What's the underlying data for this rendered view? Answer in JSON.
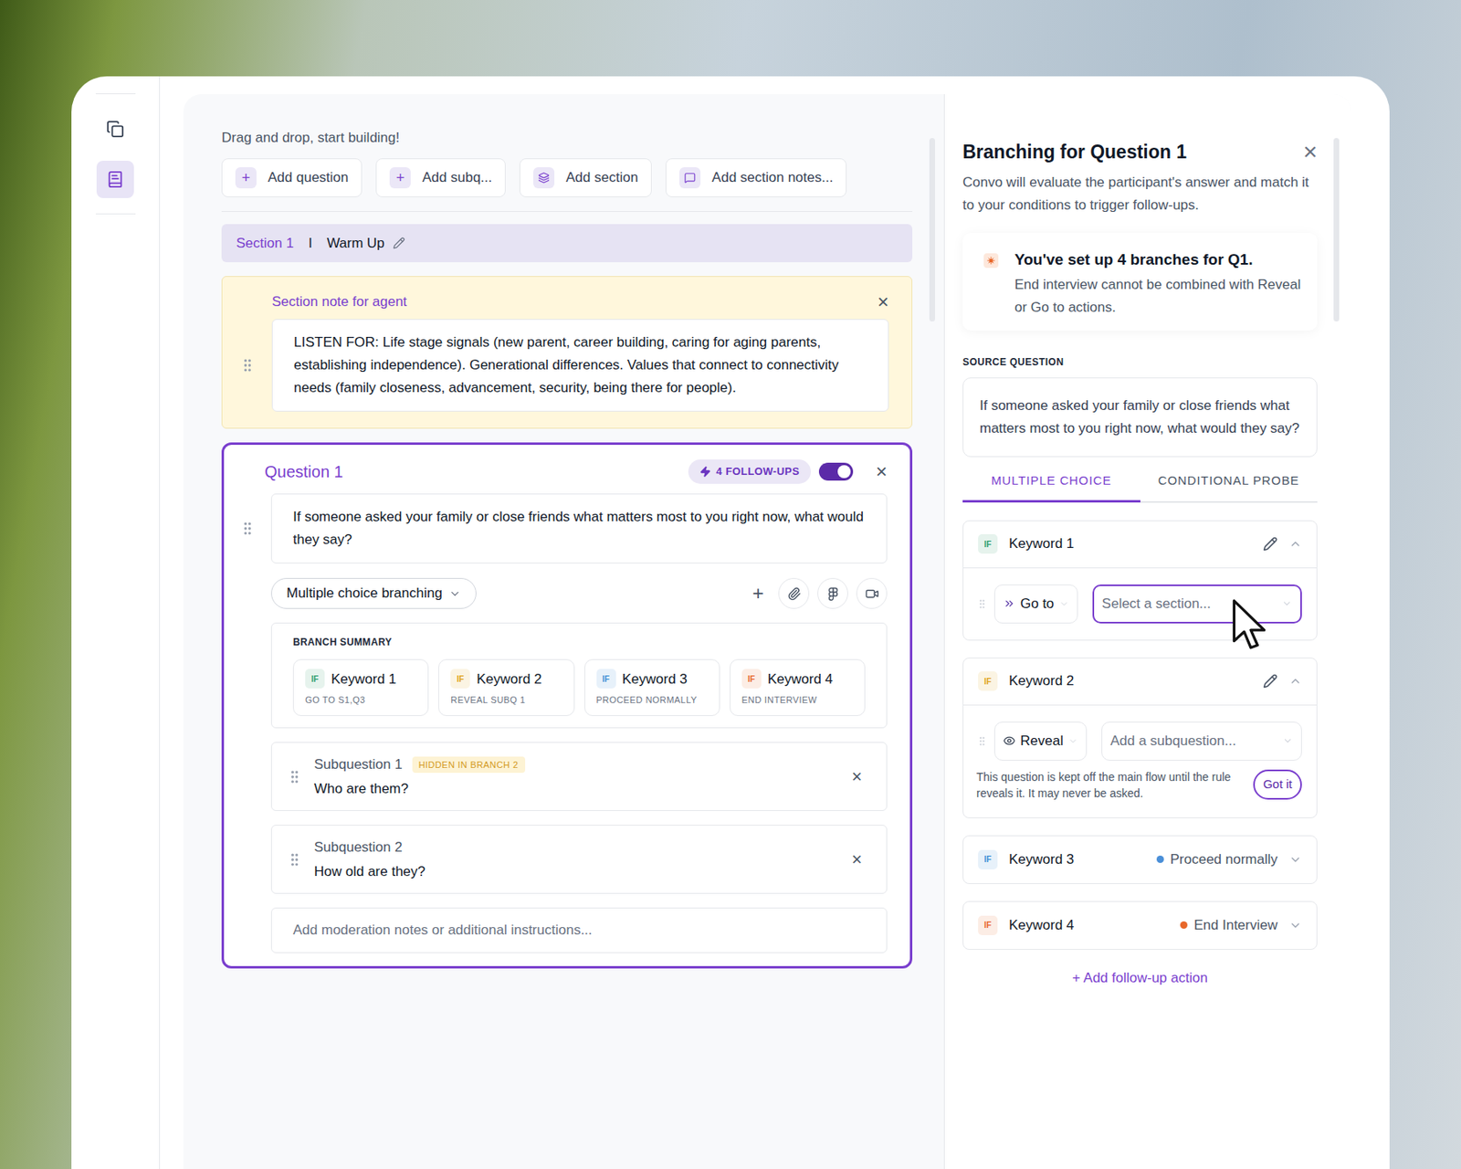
{
  "rail": {
    "items": [
      {
        "selected": false
      },
      {
        "selected": true
      }
    ]
  },
  "builder": {
    "hint": "Drag and drop, start building!",
    "toolbar": [
      {
        "label": "Add question",
        "kind": "glyph",
        "glyph": "+"
      },
      {
        "label": "Add subq...",
        "kind": "glyph",
        "glyph": "+"
      },
      {
        "label": "Add section",
        "kind": "section",
        "glyph": null
      },
      {
        "label": "Add section notes...",
        "kind": "note",
        "glyph": null
      }
    ],
    "section": {
      "label": "Section 1",
      "separator": "I",
      "title": "Warm Up"
    },
    "section_note": {
      "title": "Section note for agent",
      "close": "×",
      "body": "LISTEN FOR: Life stage signals (new parent, career building, caring for aging parents, establishing independence). Generational differences. Values that connect to connectivity needs (family closeness, advancement, security, being there for people)."
    },
    "question": {
      "title": "Question 1",
      "selected": true,
      "followups": "4 FOLLOW-UPS",
      "enabled": true,
      "close": "×",
      "text": "If someone asked your family or close friends what matters most to you right now, what would they say?",
      "branching_mode": "Multiple choice branching",
      "tool_glyph": "+",
      "branch_summary": {
        "title": "BRANCH SUMMARY",
        "branches": [
          {
            "tag": "IF",
            "keyword": "Keyword 1",
            "action": "GO TO S1,Q3",
            "color": "#2f9e6a"
          },
          {
            "tag": "IF",
            "keyword": "Keyword 2",
            "action": "REVEAL SUBQ 1",
            "color": "#e0a419"
          },
          {
            "tag": "IF",
            "keyword": "Keyword 3",
            "action": "PROCEED NORMALLY",
            "color": "#3d8fd6"
          },
          {
            "tag": "IF",
            "keyword": "Keyword 4",
            "action": "END INTERVIEW",
            "color": "#e8672a"
          }
        ]
      },
      "subquestions": [
        {
          "label": "Subquestion 1",
          "badge": "HIDDEN IN BRANCH 2",
          "text": "Who are them?",
          "close": "×"
        },
        {
          "label": "Subquestion 2",
          "badge": null,
          "text": "How old are they?",
          "close": "×"
        }
      ],
      "notes_placeholder": "Add moderation notes or additional instructions..."
    }
  },
  "panel": {
    "title": "Branching for Question 1",
    "close": "×",
    "description": "Convo will evaluate the participant's answer and match it to your conditions to trigger follow-ups.",
    "notice": {
      "title": "You've set up 4 branches for Q1.",
      "body": "End interview cannot be combined with Reveal or Go to actions."
    },
    "source_label": "SOURCE QUESTION",
    "source_text": "If someone asked your family or close friends what matters most to you right now, what would they say?",
    "tabs": [
      {
        "label": "MULTIPLE CHOICE",
        "selected": true
      },
      {
        "label": "CONDITIONAL PROBE",
        "selected": false
      }
    ],
    "rules": [
      {
        "tag": "IF",
        "keyword": "Keyword 1",
        "color": "#2f9e6a",
        "kind": "goto",
        "expanded": true,
        "action": "Go to",
        "target_placeholder": "Select a section...",
        "focused": true,
        "hint": null,
        "hint_button": null,
        "status": null,
        "status_color": null
      },
      {
        "tag": "IF",
        "keyword": "Keyword 2",
        "color": "#e0a419",
        "kind": "reveal",
        "expanded": true,
        "action": "Reveal",
        "target_placeholder": "Add a subquestion...",
        "focused": false,
        "hint": "This question is kept off the main flow until the rule reveals it. It may never be asked.",
        "hint_button": "Got it",
        "status": null,
        "status_color": null
      },
      {
        "tag": "IF",
        "keyword": "Keyword 3",
        "color": "#3d8fd6",
        "kind": "status",
        "expanded": false,
        "action": null,
        "target_placeholder": null,
        "focused": false,
        "hint": null,
        "hint_button": null,
        "status": "Proceed normally",
        "status_color": "#4a8fd8"
      },
      {
        "tag": "IF",
        "keyword": "Keyword 4",
        "color": "#e8672a",
        "kind": "status",
        "expanded": false,
        "action": null,
        "target_placeholder": null,
        "focused": false,
        "hint": null,
        "hint_button": null,
        "status": "End Interview",
        "status_color": "#e8672a"
      }
    ],
    "add_action": "+ Add follow-up action"
  }
}
